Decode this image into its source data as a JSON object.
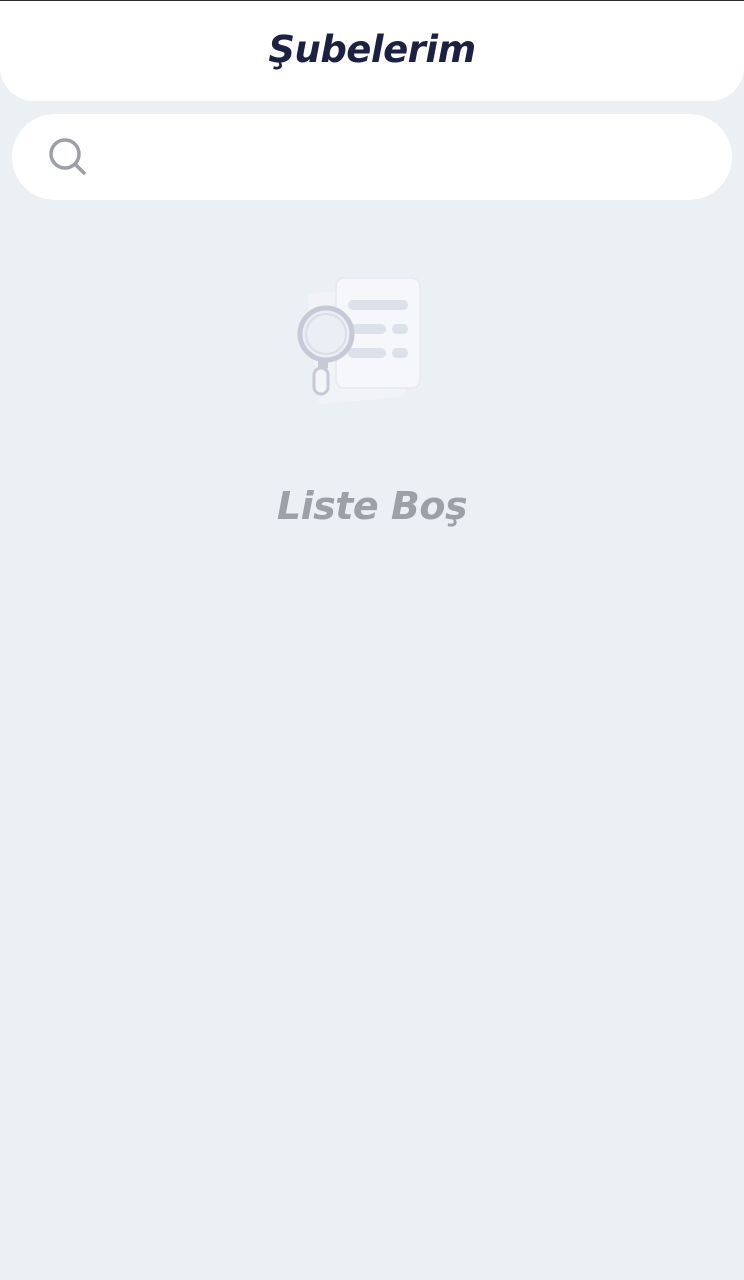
{
  "header": {
    "title": "Şubelerim"
  },
  "search": {
    "icon": "search-icon",
    "value": "",
    "placeholder": ""
  },
  "empty_state": {
    "icon": "empty-list-document-search-illustration",
    "message": "Liste Boş"
  },
  "colors": {
    "background": "#ebf0f4",
    "header_background": "#ffffff",
    "title_color": "#1c2143",
    "empty_text_color": "#9da1a7",
    "search_icon_color": "#9ca0a6"
  }
}
